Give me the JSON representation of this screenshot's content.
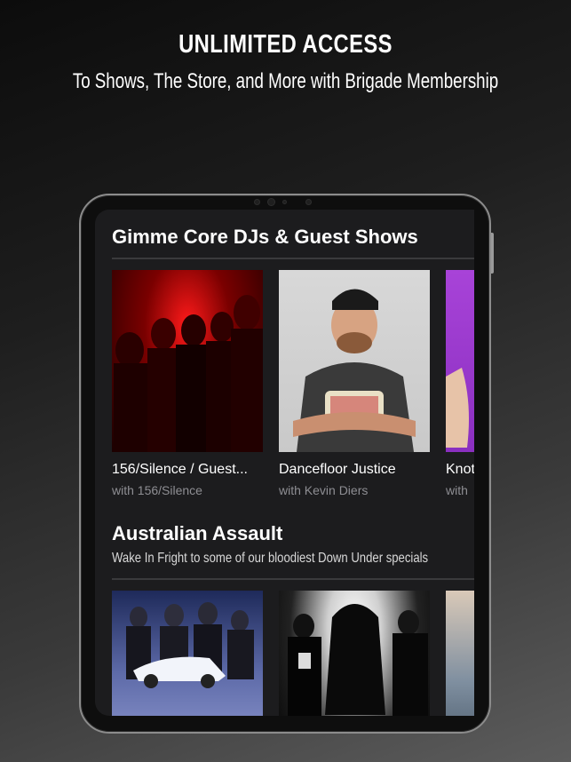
{
  "promo": {
    "title": "UNLIMITED ACCESS",
    "subtitle": "To Shows, The Store, and More with Brigade Membership"
  },
  "sections": [
    {
      "title": "Gimme Core DJs & Guest Shows",
      "subtitle": "",
      "cards": [
        {
          "title": "156/Silence / Guest...",
          "subtitle": "with 156/Silence",
          "art": "band-photo-red"
        },
        {
          "title": "Dancefloor Justice",
          "subtitle": "with Kevin Diers",
          "art": "dj-portrait"
        },
        {
          "title": "Knot",
          "subtitle": "with",
          "art": "purple-photo"
        }
      ]
    },
    {
      "title": "Australian Assault",
      "subtitle": "Wake In Fright to some of our bloodiest Down Under specials",
      "cards": [
        {
          "title": "",
          "subtitle": "",
          "art": "band-photo-blue"
        },
        {
          "title": "",
          "subtitle": "",
          "art": "band-photo-bw"
        },
        {
          "title": "",
          "subtitle": "",
          "art": "art-photo"
        }
      ]
    }
  ],
  "colors": {
    "background_top": "#0c0c0c",
    "background_bottom": "#5c5c5c",
    "screen_bg": "#1c1c1e",
    "text_primary": "#ffffff",
    "text_secondary": "#8e8e93"
  }
}
